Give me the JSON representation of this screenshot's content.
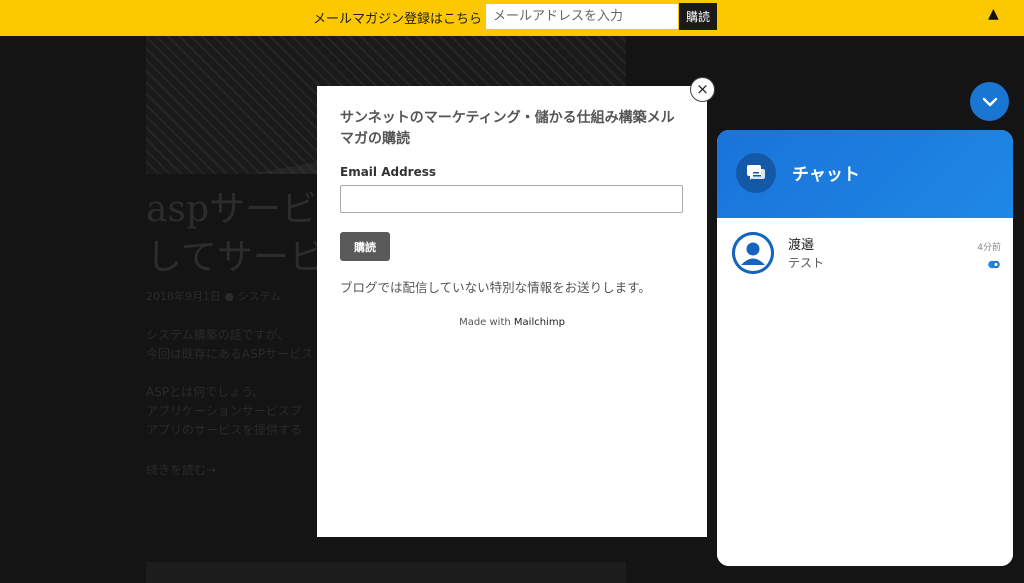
{
  "topbar": {
    "text": "メールマガジン登録はこちら",
    "input_placeholder": "メールアドレスを入力",
    "button_label": "購読",
    "collapse_icon": "▲"
  },
  "background_page": {
    "title": "aspサービ\nしてサービ",
    "meta": "2018年9月1日 ● システム",
    "paragraph": "システム構築の話ですが、\n今回は既存にあるASPサービス\n\nASPとは何でしょう。\nアプリケーションサービスプ\nアプリのサービスを提供する",
    "more": "続きを読む→"
  },
  "modal": {
    "title": "サンネットのマーケティング・儲かる仕組み構築メルマガの購読",
    "email_label": "Email Address",
    "email_value": "",
    "subscribe_label": "購読",
    "note": "ブログでは配信していない特別な情報をお送りします。",
    "made_with": "Made with",
    "brand": "Mailchimp",
    "close_icon": "×"
  },
  "chat": {
    "title": "チャット",
    "conversation": {
      "name": "渡邉",
      "message": "テスト",
      "time": "4分前"
    },
    "accent_color": "#1976d2"
  },
  "colors": {
    "topbar": "#fcc800",
    "overlay": "#141414",
    "chat_blue": "#1976d2"
  }
}
